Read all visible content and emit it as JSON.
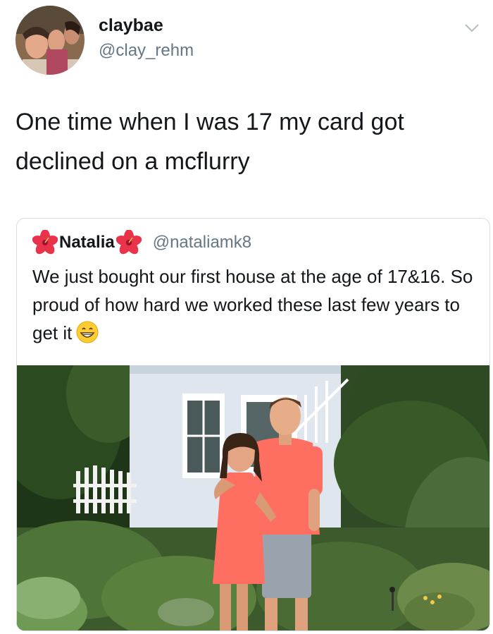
{
  "tweet": {
    "display_name": "claybae",
    "handle": "@clay_rehm",
    "text": "One time when I was 17 my card got declined on a mcflurry"
  },
  "quoted_tweet": {
    "display_name": "Natalia",
    "handle": "@nataliamk8",
    "text": "We just bought our first house at the age of 17&16. So proud of how hard we worked these last few years to get it",
    "name_decoration_icon": "hibiscus-icon",
    "text_emoji": "grinning-face-emoji"
  },
  "colors": {
    "name": "#14171a",
    "handle": "#657786",
    "card_border": "#d5dde3",
    "shirt": "#ff6f61"
  }
}
